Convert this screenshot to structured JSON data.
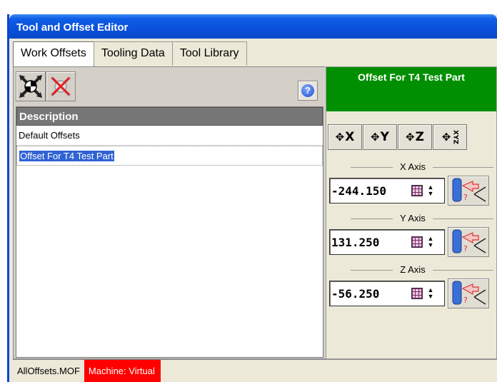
{
  "window": {
    "title": "Tool and Offset Editor"
  },
  "tabs": [
    {
      "label": "Work Offsets",
      "active": true
    },
    {
      "label": "Tooling Data",
      "active": false
    },
    {
      "label": "Tool Library",
      "active": false
    }
  ],
  "toolbar": {
    "add_icon": "new-offset-icon",
    "delete_icon": "delete-offset-icon",
    "help_label": "?"
  },
  "list": {
    "header": "Description",
    "rows": [
      {
        "label": "Default Offsets",
        "selected": false
      },
      {
        "label": "Offset For T4 Test Part",
        "selected": true
      }
    ]
  },
  "offset": {
    "title": "Offset For T4 Test Part",
    "title_color": "#008f00",
    "axis_buttons": [
      {
        "label": "X",
        "icon": "crosshair-x-icon"
      },
      {
        "label": "Y",
        "icon": "crosshair-y-icon"
      },
      {
        "label": "Z",
        "icon": "crosshair-z-icon"
      },
      {
        "label": "XYZ",
        "icon": "crosshair-xyz-icon"
      }
    ],
    "axes": [
      {
        "label": "X Axis",
        "value": "-244.150"
      },
      {
        "label": "Y Axis",
        "value": "131.250"
      },
      {
        "label": "Z Axis",
        "value": "-56.250"
      }
    ]
  },
  "status": {
    "file": "AllOffsets.MOF",
    "machine": "Machine: Virtual",
    "machine_color": "#ff0000"
  }
}
